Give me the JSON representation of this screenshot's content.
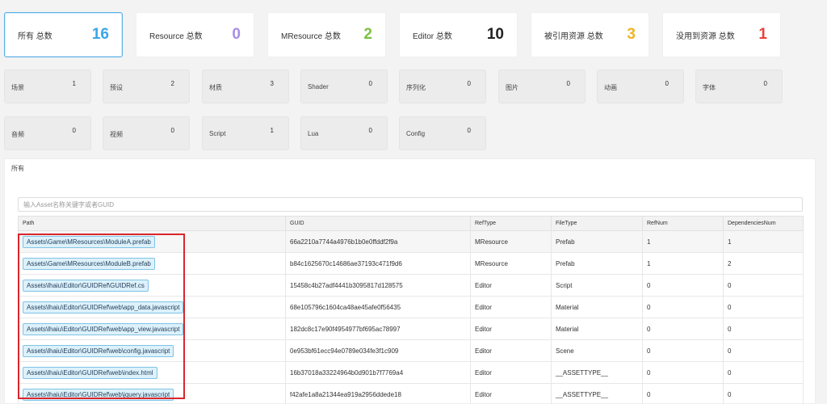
{
  "summary": [
    {
      "label": "所有 总数",
      "value": "16",
      "color": "#3aa5e8",
      "active": true
    },
    {
      "label": "Resource 总数",
      "value": "0",
      "color": "#a98de6",
      "active": false
    },
    {
      "label": "MResource 总数",
      "value": "2",
      "color": "#7ac143",
      "active": false
    },
    {
      "label": "Editor 总数",
      "value": "10",
      "color": "#222222",
      "active": false
    },
    {
      "label": "被引用资源 总数",
      "value": "3",
      "color": "#f0b323",
      "active": false
    },
    {
      "label": "没用到资源 总数",
      "value": "1",
      "color": "#e8413c",
      "active": false
    }
  ],
  "types": [
    {
      "label": "场景",
      "value": "1"
    },
    {
      "label": "预设",
      "value": "2"
    },
    {
      "label": "材质",
      "value": "3"
    },
    {
      "label": "Shader",
      "value": "0"
    },
    {
      "label": "序列化",
      "value": "0"
    },
    {
      "label": "图片",
      "value": "0"
    },
    {
      "label": "动画",
      "value": "0"
    },
    {
      "label": "字体",
      "value": "0"
    },
    {
      "label": "音频",
      "value": "0"
    },
    {
      "label": "视频",
      "value": "0"
    },
    {
      "label": "Script",
      "value": "1"
    },
    {
      "label": "Lua",
      "value": "0"
    },
    {
      "label": "Config",
      "value": "0"
    }
  ],
  "panel": {
    "title": "所有",
    "search_placeholder": "输入Asset名称关键字或者GUID"
  },
  "table": {
    "headers": [
      "Path",
      "GUID",
      "RefType",
      "FileType",
      "RefNum",
      "DependenciesNum"
    ],
    "rows": [
      [
        "Assets\\Game\\MResources\\ModuleA.prefab",
        "66a2210a7744a4976b1b0e0ffddf2f9a",
        "MResource",
        "Prefab",
        "1",
        "1"
      ],
      [
        "Assets\\Game\\MResources\\ModuleB.prefab",
        "b84c1625670c14686ae37193c471f9d6",
        "MResource",
        "Prefab",
        "1",
        "2"
      ],
      [
        "Assets\\lhaiu\\Editor\\GUIDRef\\GUIDRef.cs",
        "15458c4b27adf4441b3095817d128575",
        "Editor",
        "Script",
        "0",
        "0"
      ],
      [
        "Assets\\lhaiu\\Editor\\GUIDRef\\web\\app_data.javascript",
        "68e105796c1604ca48ae45afe0f56435",
        "Editor",
        "Material",
        "0",
        "0"
      ],
      [
        "Assets\\lhaiu\\Editor\\GUIDRef\\web\\app_view.javascript",
        "182dc8c17e90f4954977bf695ac78997",
        "Editor",
        "Material",
        "0",
        "0"
      ],
      [
        "Assets\\lhaiu\\Editor\\GUIDRef\\web\\config.javascript",
        "0e953bf61ecc94e0789e034fe3f1c909",
        "Editor",
        "Scene",
        "0",
        "0"
      ],
      [
        "Assets\\lhaiu\\Editor\\GUIDRef\\web\\index.html",
        "16b37018a33224964b0d901b7f7769a4",
        "Editor",
        "__ASSETTYPE__",
        "0",
        "0"
      ],
      [
        "Assets\\lhaiu\\Editor\\GUIDRef\\web\\jquery.javascript",
        "f42afe1a8a21344ea919a2956ddede18",
        "Editor",
        "__ASSETTYPE__",
        "0",
        "0"
      ]
    ]
  },
  "highlight_color": "#d9262c"
}
